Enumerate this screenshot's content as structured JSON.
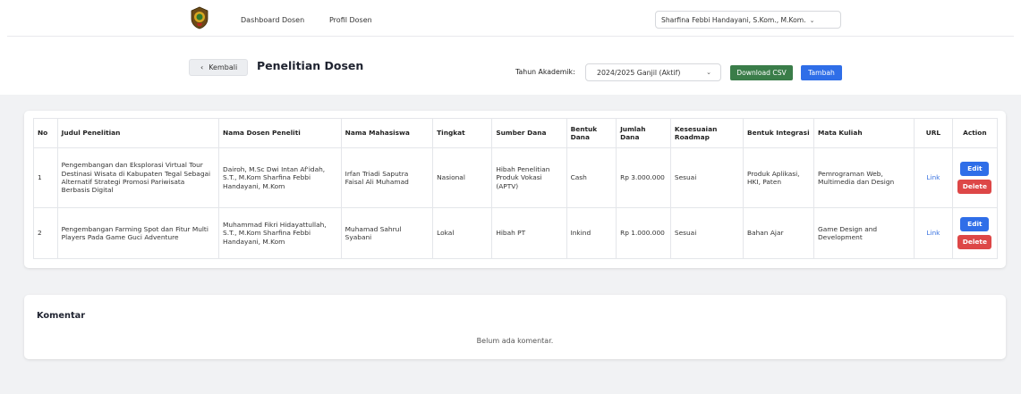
{
  "nav": {
    "links": [
      "Dashboard Dosen",
      "Profil Dosen"
    ],
    "user": "Sharfina Febbi Handayani, S.Kom., M.Kom."
  },
  "toolbar": {
    "back_label": "Kembali",
    "page_title": "Penelitian Dosen",
    "year_label": "Tahun Akademik:",
    "year_value": "2024/2025 Ganjil (Aktif)",
    "download_label": "Download CSV",
    "add_label": "Tambah"
  },
  "table": {
    "headers": [
      "No",
      "Judul Penelitian",
      "Nama Dosen Peneliti",
      "Nama Mahasiswa",
      "Tingkat",
      "Sumber Dana",
      "Bentuk Dana",
      "Jumlah Dana",
      "Kesesuaian Roadmap",
      "Bentuk Integrasi",
      "Mata Kuliah",
      "URL",
      "Action"
    ],
    "rows": [
      {
        "no": "1",
        "judul": "Pengembangan dan Eksplorasi Virtual Tour Destinasi Wisata di Kabupaten Tegal Sebagai Alternatif Strategi Promosi Pariwisata Berbasis Digital",
        "dosen": "Dairoh, M.Sc Dwi Intan Af'idah, S.T., M.Kom Sharfina Febbi Handayani, M.Kom",
        "mahasiswa": "Irfan Triadi Saputra Faisal Ali Muhamad",
        "tingkat": "Nasional",
        "sumber": "Hibah Penelitian Produk Vokasi (APTV)",
        "bentuk_dana": "Cash",
        "jumlah": "Rp 3.000.000",
        "roadmap": "Sesuai",
        "integrasi": "Produk Aplikasi, HKI, Paten",
        "mata_kuliah": "Pemrograman Web, Multimedia dan Design",
        "url": "Link",
        "edit": "Edit",
        "delete": "Delete"
      },
      {
        "no": "2",
        "judul": "Pengembangan Farming Spot dan Fitur Multi Players Pada Game Guci Adventure",
        "dosen": "Muhammad Fikri Hidayattullah, S.T., M.Kom Sharfina Febbi Handayani, M.Kom",
        "mahasiswa": "Muhamad Sahrul Syabani",
        "tingkat": "Lokal",
        "sumber": "Hibah PT",
        "bentuk_dana": "Inkind",
        "jumlah": "Rp 1.000.000",
        "roadmap": "Sesuai",
        "integrasi": "Bahan Ajar",
        "mata_kuliah": "Game Design and Development",
        "url": "Link",
        "edit": "Edit",
        "delete": "Delete"
      }
    ]
  },
  "comments": {
    "title": "Komentar",
    "empty": "Belum ada komentar."
  },
  "colors": {
    "primary": "#2f6ee8",
    "success": "#3a7d49",
    "danger": "#dd4747",
    "link": "#3a73e0"
  }
}
